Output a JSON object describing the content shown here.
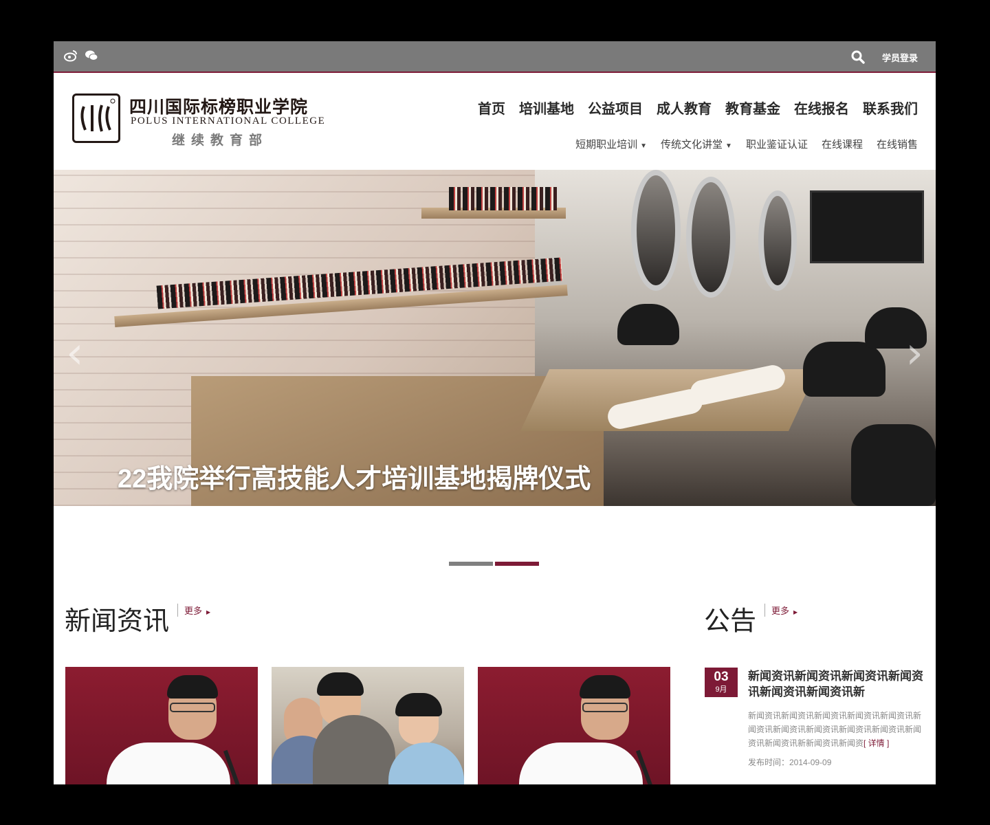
{
  "topbar": {
    "icons": [
      "weibo-icon",
      "wechat-icon",
      "search-icon"
    ],
    "login_label": "学员登录"
  },
  "header": {
    "logo_cn": "四川国际标榜职业学院",
    "logo_en": "POLUS INTERNATIONAL COLLEGE",
    "logo_sub": "继续教育部"
  },
  "main_nav": [
    "首页",
    "培训基地",
    "公益项目",
    "成人教育",
    "教育基金",
    "在线报名",
    "联系我们"
  ],
  "sub_nav": [
    {
      "label": "短期职业培训",
      "dropdown": true
    },
    {
      "label": "传统文化讲堂",
      "dropdown": true
    },
    {
      "label": "职业鉴证认证",
      "dropdown": false
    },
    {
      "label": "在线课程",
      "dropdown": false
    },
    {
      "label": "在线销售",
      "dropdown": false
    }
  ],
  "banner": {
    "caption": "22我院举行高技能人才培训基地揭牌仪式",
    "prev_arrow": "‹",
    "next_arrow": "›",
    "slides_total": 2,
    "active_slide": 2
  },
  "news": {
    "title": "新闻资讯",
    "more": "更多"
  },
  "notice": {
    "title": "公告",
    "more": "更多",
    "item": {
      "day": "03",
      "month": "9月",
      "title": "新闻资讯新闻资讯新闻资讯新闻资讯新闻资讯新闻资讯新",
      "body": "新闻资讯新闻资讯新闻资讯新闻资讯新闻资讯新闻资讯新闻资讯新闻资讯新闻资讯新闻资讯新闻资讯新闻资讯新新闻资讯新闻资",
      "detail": "[ 详情 ]",
      "time": "发布时间：2014-09-09"
    }
  },
  "colors": {
    "brand": "#7d1a36",
    "topbar": "#7a7a7a",
    "pager_inactive": "#808080"
  }
}
